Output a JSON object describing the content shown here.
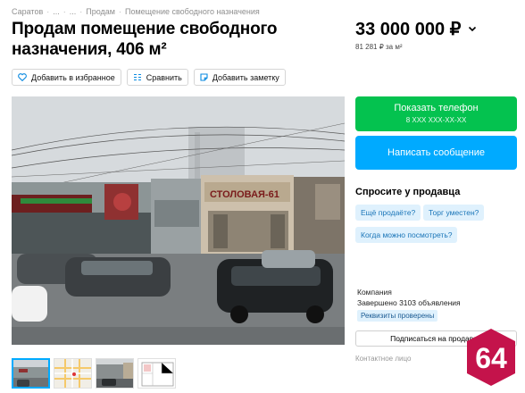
{
  "breadcrumb": {
    "items": [
      "Саратов",
      "...",
      "...",
      "Продам",
      "Помещение свободного назначения"
    ],
    "separator": "·"
  },
  "title": "Продам помещение свободного назначения, 406 м²",
  "actions": {
    "favorite": "Добавить в избранное",
    "compare": "Сравнить",
    "note": "Добавить заметку"
  },
  "photo": {
    "sign_text": "СТОЛОВАЯ-61",
    "shop_text": "ФРЕШ"
  },
  "thumbnails": {
    "count": 4,
    "active_index": 0
  },
  "price": {
    "value": "33 000 000 ₽",
    "per_m2": "81 281 ₽ за м²"
  },
  "contact": {
    "show_phone": "Показать телефон",
    "phone_mask": "8 XXX XXX-XX-XX",
    "write_message": "Написать сообщение"
  },
  "ask": {
    "title": "Спросите у продавца",
    "chips": [
      "Ещё продаёте?",
      "Торг уместен?",
      "Когда можно посмотреть?"
    ]
  },
  "seller": {
    "type": "Компания",
    "completed": "Завершено 3103 объявления",
    "verified": "Реквизиты проверены",
    "subscribe": "Подписаться на продавца",
    "contact_person_label": "Контактное лицо"
  },
  "logo": {
    "text": "64",
    "color": "#c4134b"
  },
  "colors": {
    "green": "#04c24f",
    "blue": "#00aaff",
    "chip_bg": "#dff1fd"
  }
}
